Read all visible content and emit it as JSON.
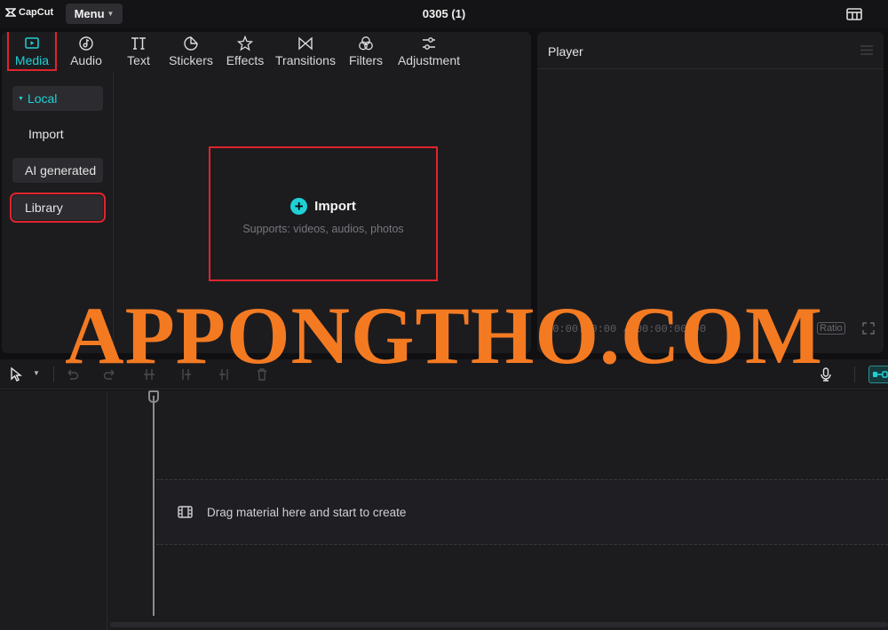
{
  "titlebar": {
    "brand": "CapCut",
    "menu_label": "Menu",
    "project_title": "0305 (1)"
  },
  "tabs": [
    {
      "label": "Media",
      "icon": "media-icon",
      "active": true
    },
    {
      "label": "Audio",
      "icon": "audio-icon"
    },
    {
      "label": "Text",
      "icon": "text-icon"
    },
    {
      "label": "Stickers",
      "icon": "stickers-icon"
    },
    {
      "label": "Effects",
      "icon": "effects-icon"
    },
    {
      "label": "Transitions",
      "icon": "transitions-icon"
    },
    {
      "label": "Filters",
      "icon": "filters-icon"
    },
    {
      "label": "Adjustment",
      "icon": "adjustment-icon"
    }
  ],
  "sidebar": {
    "local": "Local",
    "import": "Import",
    "ai_generated": "AI generated",
    "library": "Library"
  },
  "import_panel": {
    "label": "Import",
    "subtext": "Supports: videos, audios, photos"
  },
  "player": {
    "title": "Player",
    "timecode": "00:00:00:00 / 00:00:00:00",
    "ratio_label": "Ratio"
  },
  "timeline": {
    "drop_hint": "Drag material here and start to create"
  },
  "watermark": "APPONGTHO.COM",
  "colors": {
    "accent": "#1fd1d6",
    "highlight_border": "#e0242e",
    "watermark": "#f47a22",
    "panel_bg": "#1c1c1f"
  }
}
